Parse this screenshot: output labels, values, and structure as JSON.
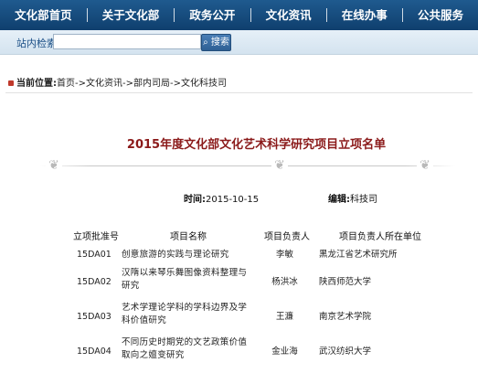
{
  "nav": {
    "items": [
      "文化部首页",
      "关于文化部",
      "政务公开",
      "文化资讯",
      "在线办事",
      "公共服务"
    ]
  },
  "search": {
    "label": "站内检索",
    "value": "",
    "button": "搜索"
  },
  "breadcrumb": {
    "head": "当前位置:",
    "path": "首页->文化资讯->部内司局->文化科技司"
  },
  "article": {
    "title": "2015年度文化部文化艺术科学研究项目立项名单",
    "date_label": "时间:",
    "date": "2015-10-15",
    "editor_label": "编辑:",
    "editor": "科技司"
  },
  "table": {
    "headers": [
      "立项批准号",
      "项目名称",
      "项目负责人",
      "项目负责人所在单位"
    ],
    "rows": [
      {
        "code": "15DA01",
        "name": "创意旅游的实践与理论研究",
        "lead": "李敏",
        "unit": "黑龙江省艺术研究所"
      },
      {
        "code": "15DA02",
        "name": "汉隋以来琴乐舞图像资料整理与研究",
        "lead": "杨洪冰",
        "unit": "陕西师范大学"
      },
      {
        "code": "15DA03",
        "name": "艺术学理论学科的学科边界及学科价值研究",
        "lead": "王濂",
        "unit": "南京艺术学院"
      },
      {
        "code": "15DA04",
        "name": "不同历史时期党的文艺政策价值取向之嬗变研究",
        "lead": "金业海",
        "unit": "武汉纺织大学"
      }
    ]
  },
  "colors": {
    "nav_bg": "#134676",
    "title_red": "#8b1a1a",
    "crumb_pin": "#c0392b"
  }
}
